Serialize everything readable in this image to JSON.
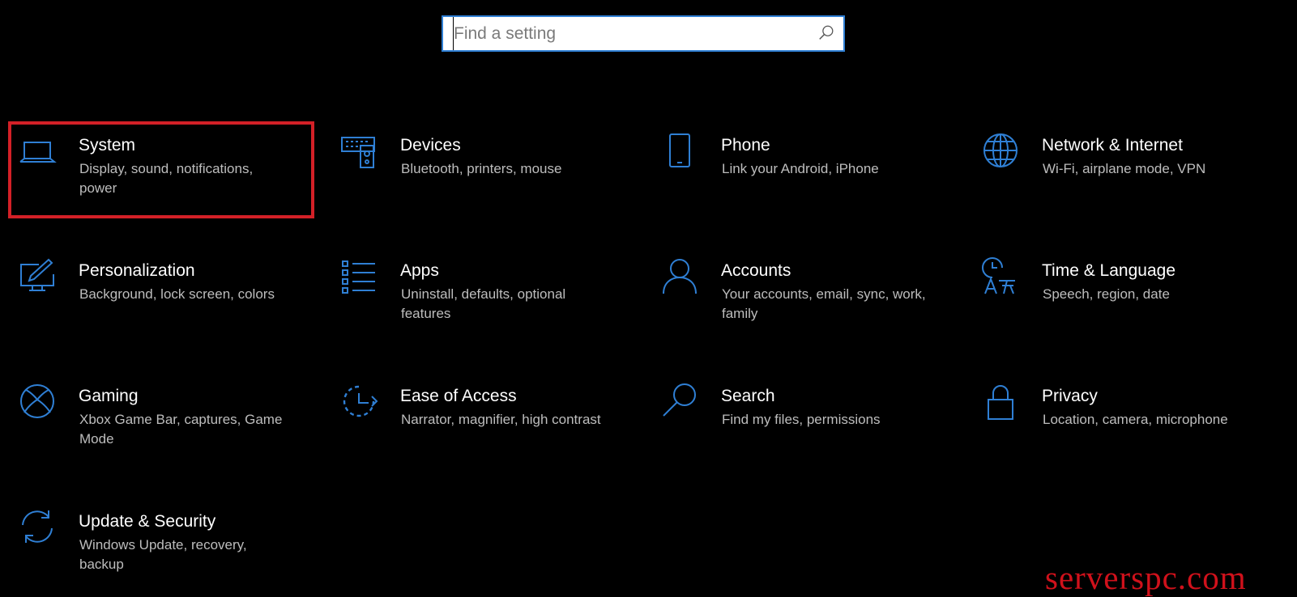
{
  "search": {
    "placeholder": "Find a setting",
    "value": ""
  },
  "accent_color": "#2f7fd4",
  "highlight_color": "#d32027",
  "tiles": [
    {
      "title": "System",
      "desc": "Display, sound, notifications, power",
      "icon": "laptop-icon"
    },
    {
      "title": "Devices",
      "desc": "Bluetooth, printers, mouse",
      "icon": "keyboard-speaker-icon"
    },
    {
      "title": "Phone",
      "desc": "Link your Android, iPhone",
      "icon": "phone-icon"
    },
    {
      "title": "Network & Internet",
      "desc": "Wi-Fi, airplane mode, VPN",
      "icon": "globe-icon"
    },
    {
      "title": "Personalization",
      "desc": "Background, lock screen, colors",
      "icon": "monitor-pen-icon"
    },
    {
      "title": "Apps",
      "desc": "Uninstall, defaults, optional features",
      "icon": "app-list-icon"
    },
    {
      "title": "Accounts",
      "desc": "Your accounts, email, sync, work, family",
      "icon": "person-icon"
    },
    {
      "title": "Time & Language",
      "desc": "Speech, region, date",
      "icon": "time-language-icon"
    },
    {
      "title": "Gaming",
      "desc": "Xbox Game Bar, captures, Game Mode",
      "icon": "xbox-icon"
    },
    {
      "title": "Ease of Access",
      "desc": "Narrator, magnifier, high contrast",
      "icon": "ease-of-access-icon"
    },
    {
      "title": "Search",
      "desc": "Find my files, permissions",
      "icon": "search-magnifier-icon"
    },
    {
      "title": "Privacy",
      "desc": "Location, camera, microphone",
      "icon": "lock-icon"
    },
    {
      "title": "Update & Security",
      "desc": "Windows Update, recovery, backup",
      "icon": "sync-arrows-icon"
    }
  ],
  "watermark": "serverspc.com"
}
